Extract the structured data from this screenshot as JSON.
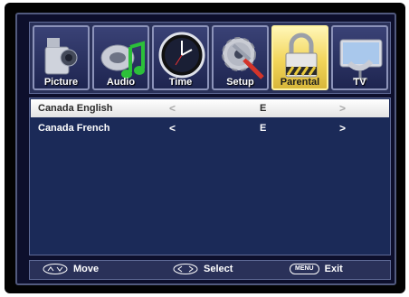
{
  "tabs": [
    {
      "label": "Picture",
      "icon": "camcorder-icon"
    },
    {
      "label": "Audio",
      "icon": "music-note-icon"
    },
    {
      "label": "Time",
      "icon": "clock-icon"
    },
    {
      "label": "Setup",
      "icon": "gear-wrench-icon"
    },
    {
      "label": "Parental",
      "icon": "padlock-icon",
      "active": true
    },
    {
      "label": "TV",
      "icon": "satellite-dish-icon"
    }
  ],
  "rows": [
    {
      "label": "Canada English",
      "left_arrow": "<",
      "value": "E",
      "right_arrow": ">",
      "selected": true
    },
    {
      "label": "Canada French",
      "left_arrow": "<",
      "value": "E",
      "right_arrow": ">",
      "selected": false
    }
  ],
  "footer": {
    "move_label": "Move",
    "select_label": "Select",
    "menu_key": "MENU",
    "exit_label": "Exit"
  },
  "colors": {
    "active_tab": "#f2d55a",
    "panel_bg": "#1b2a58",
    "selected_row": "#ffffff"
  }
}
